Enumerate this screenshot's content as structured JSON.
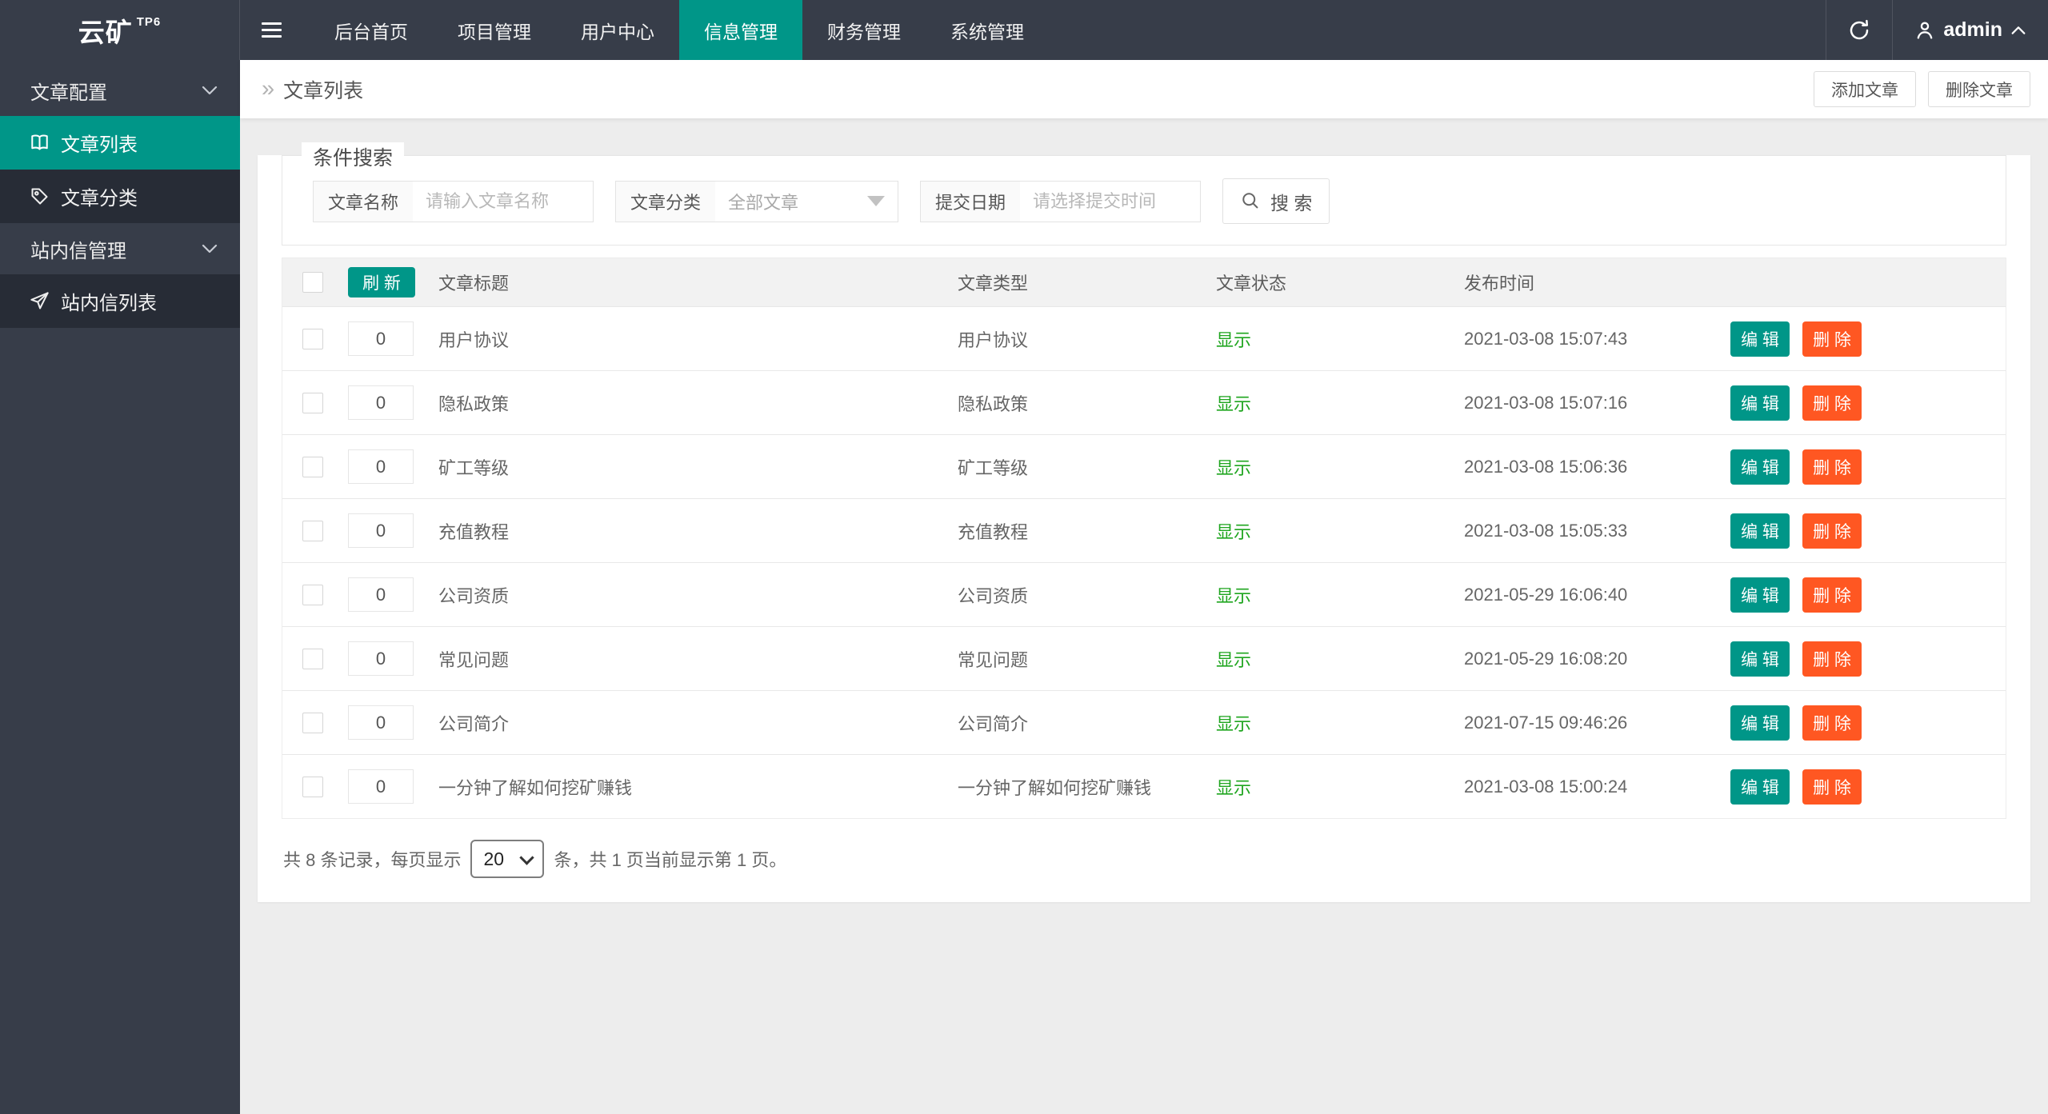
{
  "colors": {
    "accent_teal": "#009688",
    "danger_orange": "#ff5722",
    "status_green": "#1ea51e",
    "topbar_dark": "#373d49",
    "sidebar_item_dark": "#272c36",
    "body_gray": "#ededed"
  },
  "topbar": {
    "logo": "云矿",
    "logo_badge": "TP6",
    "nav": [
      {
        "label": "后台首页"
      },
      {
        "label": "项目管理"
      },
      {
        "label": "用户中心"
      },
      {
        "label": "信息管理"
      },
      {
        "label": "财务管理"
      },
      {
        "label": "系统管理"
      }
    ],
    "active_nav": "信息管理",
    "username": "admin"
  },
  "sidebar": {
    "groups": [
      {
        "label": "文章配置"
      },
      {
        "label": "站内信管理"
      }
    ],
    "items": [
      {
        "label": "文章列表"
      },
      {
        "label": "文章分类"
      },
      {
        "label": "站内信列表"
      }
    ],
    "active_item": "文章列表"
  },
  "breadcrumb": {
    "separator": "»",
    "title": "文章列表"
  },
  "page_actions": {
    "add": "添加文章",
    "remove": "删除文章"
  },
  "search": {
    "legend": "条件搜索",
    "name_label": "文章名称",
    "name_placeholder": "请输入文章名称",
    "category_label": "文章分类",
    "category_value": "全部文章",
    "date_label": "提交日期",
    "date_placeholder": "请选择提交时间",
    "submit": "搜 索"
  },
  "table": {
    "refresh": "刷 新",
    "columns": {
      "title": "文章标题",
      "type": "文章类型",
      "status": "文章状态",
      "time": "发布时间"
    },
    "edit": "编 辑",
    "remove": "删 除",
    "rows": [
      {
        "sort": "0",
        "title": "用户协议",
        "type": "用户协议",
        "status": "显示",
        "time": "2021-03-08 15:07:43"
      },
      {
        "sort": "0",
        "title": "隐私政策",
        "type": "隐私政策",
        "status": "显示",
        "time": "2021-03-08 15:07:16"
      },
      {
        "sort": "0",
        "title": "矿工等级",
        "type": "矿工等级",
        "status": "显示",
        "time": "2021-03-08 15:06:36"
      },
      {
        "sort": "0",
        "title": "充值教程",
        "type": "充值教程",
        "status": "显示",
        "time": "2021-03-08 15:05:33"
      },
      {
        "sort": "0",
        "title": "公司资质",
        "type": "公司资质",
        "status": "显示",
        "time": "2021-05-29 16:06:40"
      },
      {
        "sort": "0",
        "title": "常见问题",
        "type": "常见问题",
        "status": "显示",
        "time": "2021-05-29 16:08:20"
      },
      {
        "sort": "0",
        "title": "公司简介",
        "type": "公司简介",
        "status": "显示",
        "time": "2021-07-15 09:46:26"
      },
      {
        "sort": "0",
        "title": "一分钟了解如何挖矿赚钱",
        "type": "一分钟了解如何挖矿赚钱",
        "status": "显示",
        "time": "2021-03-08 15:00:24"
      }
    ]
  },
  "pagination": {
    "prefix": "共 8 条记录，每页显示",
    "page_size": "20",
    "suffix": "条，共 1 页当前显示第 1 页。"
  },
  "icons": {
    "menu": "hamburger-icon",
    "refresh": "refresh-icon",
    "user": "person-icon",
    "user_caret": "chevron-up-icon",
    "group_caret": "chevron-down-icon",
    "article_list": "book-icon",
    "article_category": "tag-icon",
    "message_list": "send-icon",
    "search": "magnifier-icon",
    "select_caret": "triangle-down-icon"
  }
}
